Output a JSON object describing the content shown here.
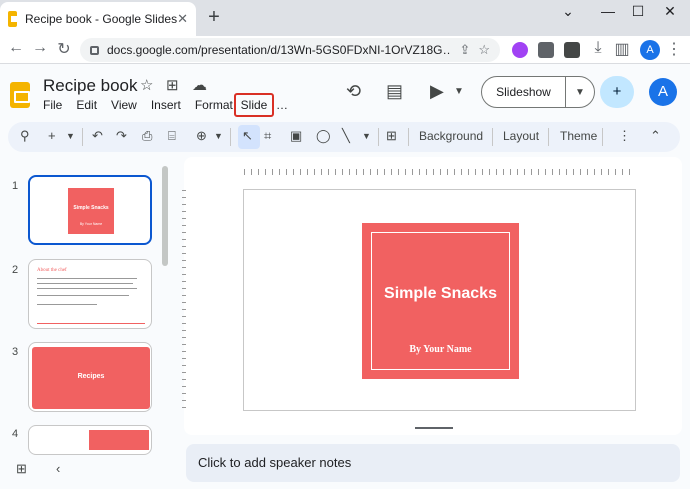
{
  "browser": {
    "tab_title": "Recipe book - Google Slides",
    "tab_close": "✕",
    "new_tab": "+",
    "window_controls": [
      "⌄",
      "—",
      "☐",
      "✕"
    ],
    "url": "docs.google.com/presentation/d/13Wn-5GS0FDxNI-1OrVZ18G…",
    "profile_initial": "A"
  },
  "app": {
    "doc_title": "Recipe book",
    "menu": [
      "File",
      "Edit",
      "View",
      "Insert",
      "Format"
    ],
    "highlighted_menu": "Slide",
    "menu_overflow": "…",
    "slideshow_label": "Slideshow",
    "profile_initial": "A"
  },
  "toolbar": {
    "background_label": "Background",
    "layout_label": "Layout",
    "theme_label": "Theme"
  },
  "filmstrip": {
    "slides": [
      {
        "number": "1",
        "title": "Simple Snacks",
        "subtitle": "By Your Name"
      },
      {
        "number": "2",
        "title": "About the chef"
      },
      {
        "number": "3",
        "title": "Recipes"
      },
      {
        "number": "4"
      }
    ]
  },
  "slide": {
    "title": "Simple Snacks",
    "subtitle": "By Your Name"
  },
  "notes": {
    "placeholder": "Click to add speaker notes"
  },
  "colors": {
    "accent_red": "#f16161",
    "selection_blue": "#0b57d0",
    "highlight_border": "#d93025"
  }
}
